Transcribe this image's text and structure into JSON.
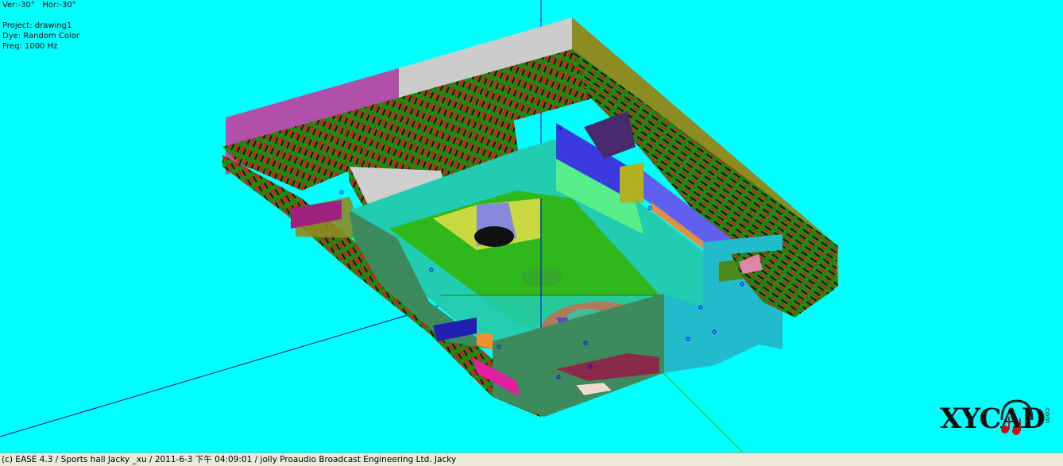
{
  "view": {
    "ver_label": "Ver:-30°",
    "hor_label": "Hor:-30°"
  },
  "project": {
    "project_line": "Project: drawing1",
    "dye_line": "Dye: Random Color",
    "freq_line": "Freq: 1000 Hz"
  },
  "status_bar": {
    "text": "(c) EASE 4.3  / Sports hall Jacky _xu / 2011-6-3 下午 04:09:01 / jolly Proaudio Broadcast Engineering Ltd. Jacky"
  },
  "logo": {
    "text": "XYCAD",
    "suffix": ".com"
  },
  "colors": {
    "background": "#00ffff",
    "court_cyan": "#22ccb0",
    "court_green": "#2fb81c",
    "seating_green": "#1e8a12",
    "seat_red": "#e01818",
    "wall_olive": "#8c8c22",
    "axis_blue": "#0000ff",
    "axis_green": "#00c000"
  }
}
